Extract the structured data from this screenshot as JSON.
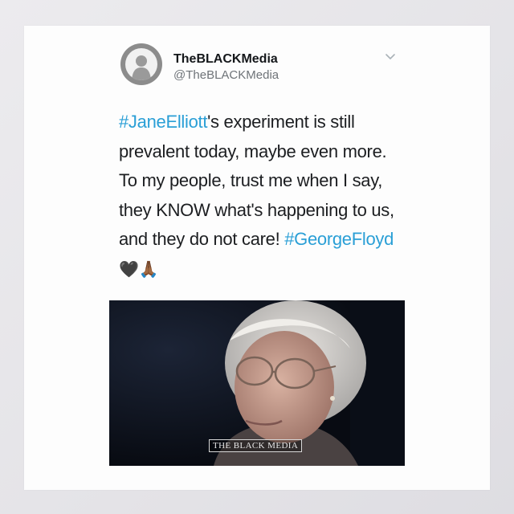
{
  "tweet": {
    "author": {
      "display_name": "TheBLACKMedia",
      "handle": "@TheBLACKMedia",
      "avatar_icon": "silhouette-avatar-icon"
    },
    "menu_icon": "chevron-down-icon",
    "text_segments": [
      {
        "type": "hashtag",
        "text": "#JaneElliott"
      },
      {
        "type": "text",
        "text": "'s experiment is still prevalent today, maybe even more. To my people, trust me when I say, they KNOW what's happening to us, and they do not care! "
      },
      {
        "type": "hashtag",
        "text": "#GeorgeFloyd"
      },
      {
        "type": "text",
        "text": " "
      },
      {
        "type": "emoji",
        "text": "🖤"
      },
      {
        "type": "emoji",
        "text": "🙏🏾"
      }
    ],
    "hashtag_color": "#2a9fd6",
    "media": {
      "type": "video-still",
      "watermark": "THE BLACK MEDIA"
    }
  }
}
